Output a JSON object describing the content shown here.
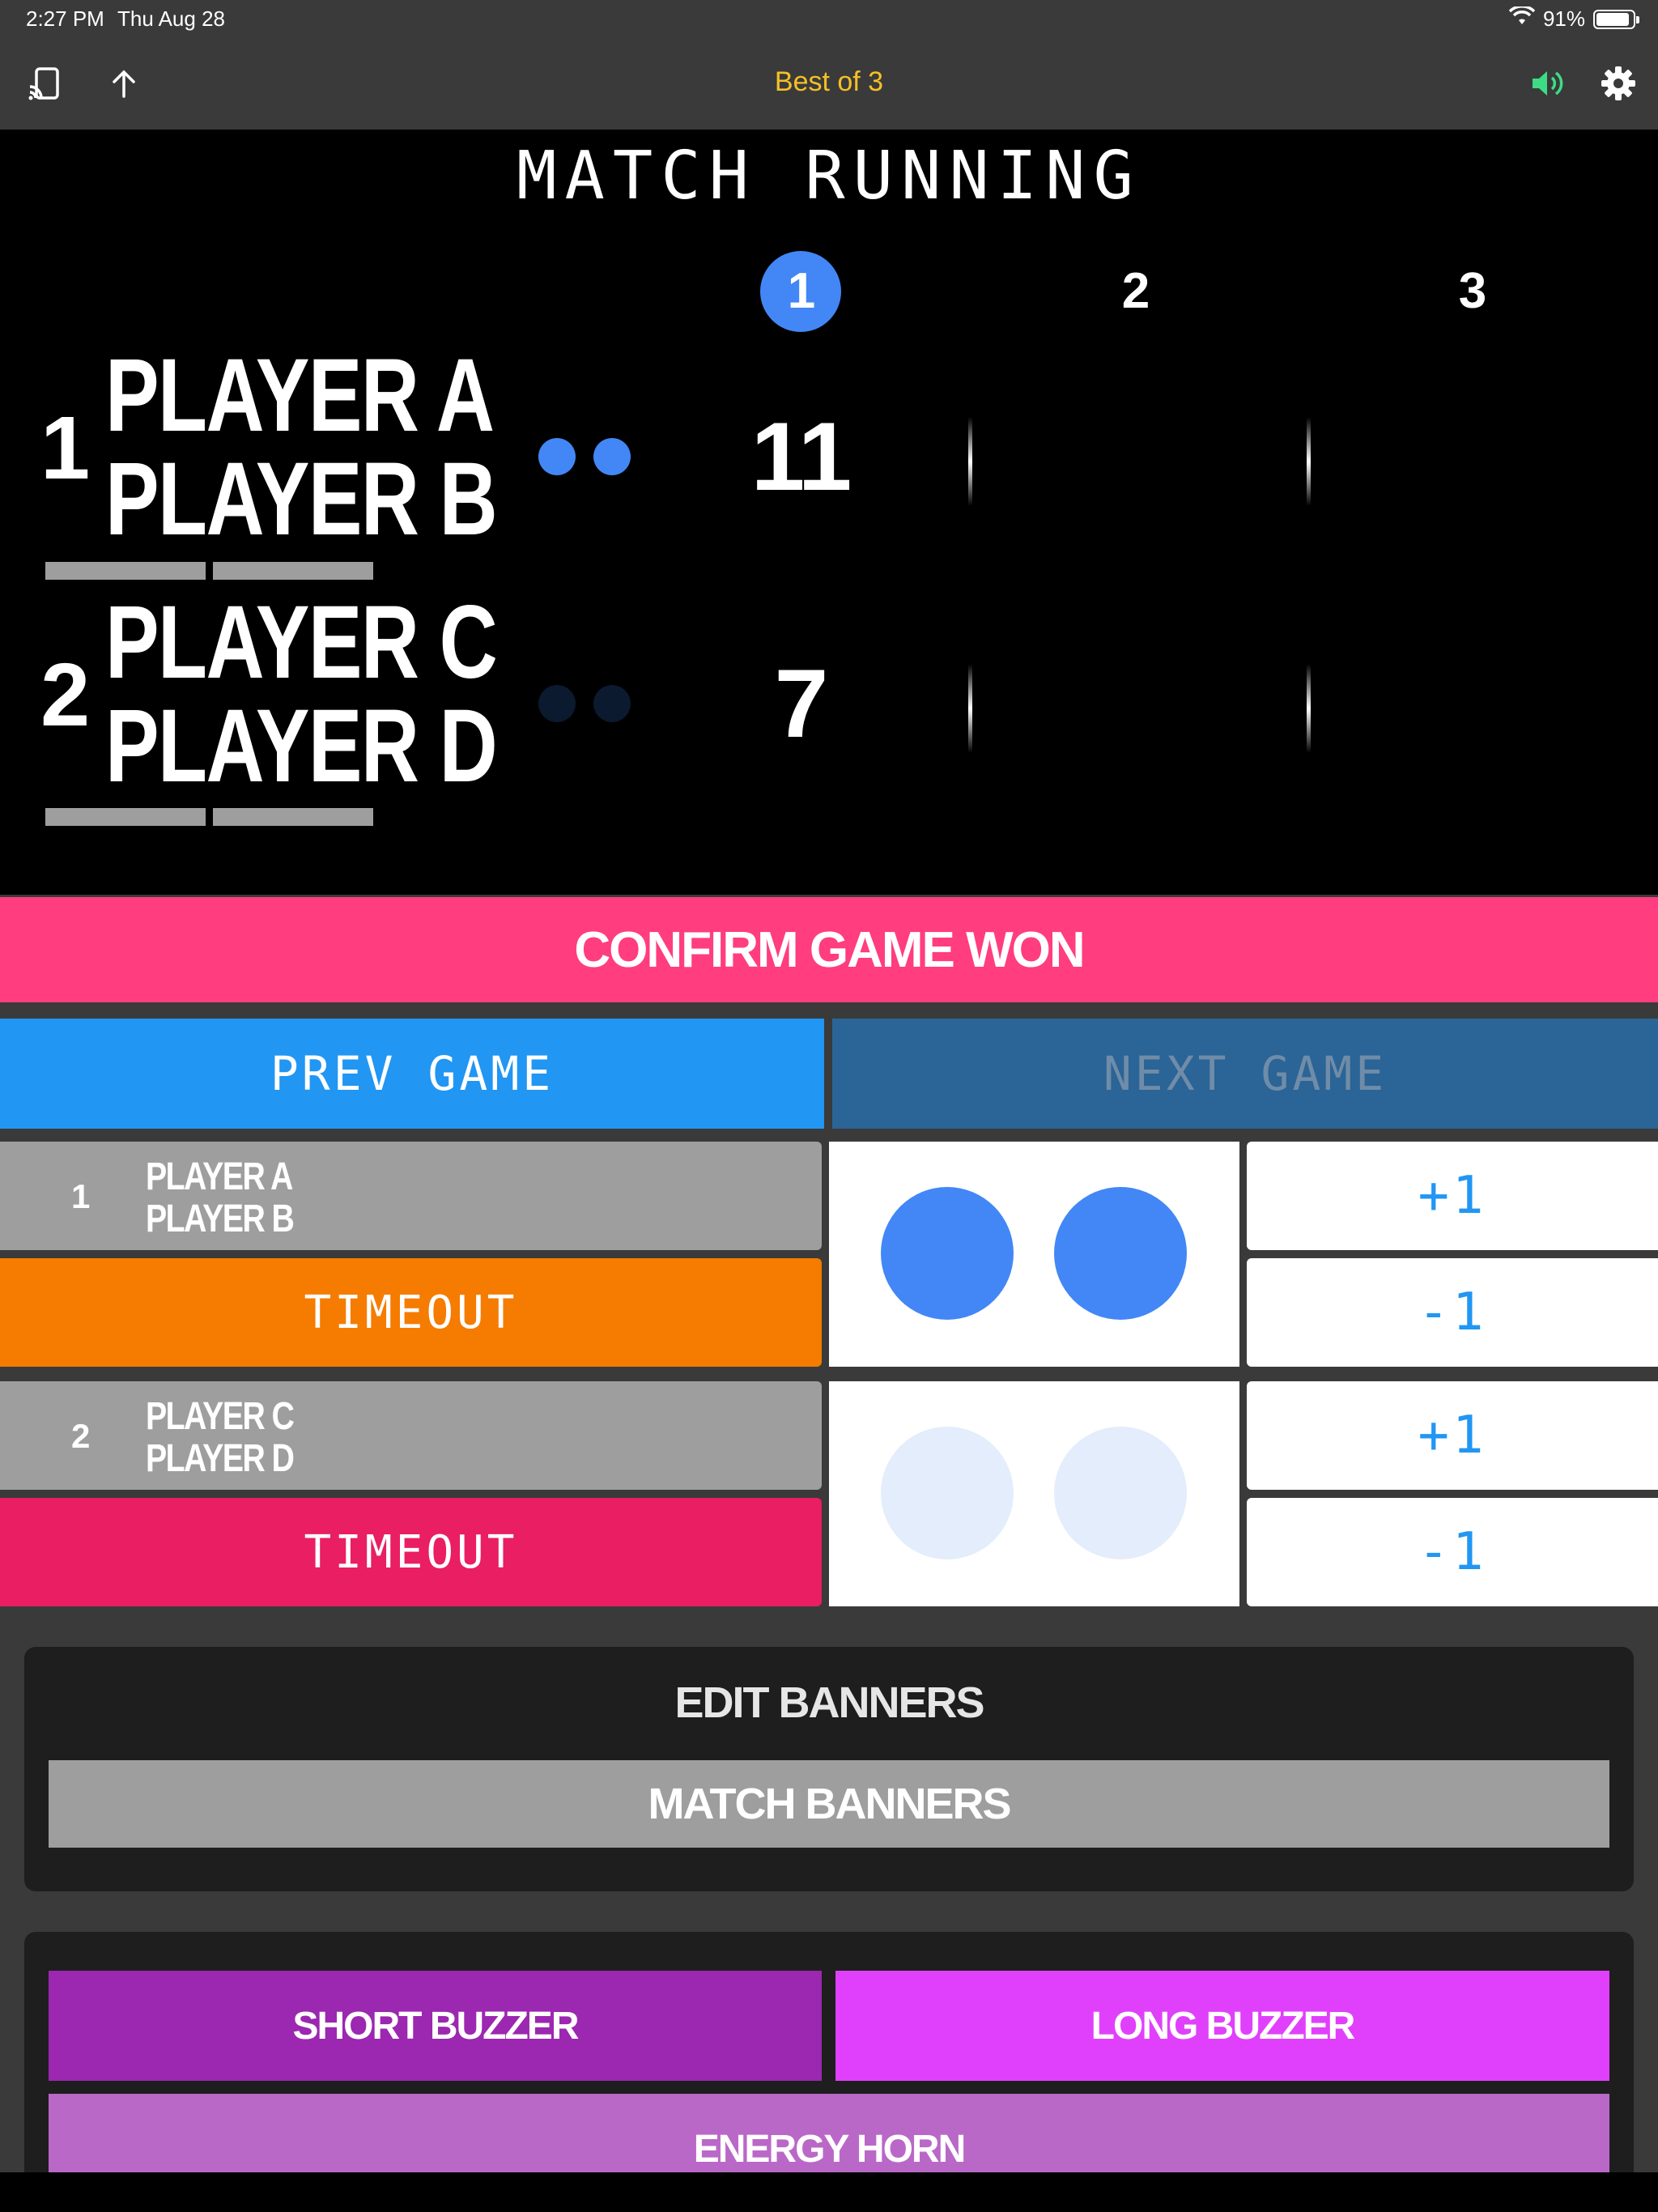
{
  "status_bar": {
    "time": "2:27 PM",
    "date": "Thu Aug 28",
    "battery": "91%",
    "battery_level": 0.91
  },
  "toolbar": {
    "title": "Best of 3",
    "icons": [
      "cast-icon",
      "arrow-up-icon",
      "volume-icon",
      "gear-icon"
    ],
    "accent_color": "#f5c026",
    "volume_color": "#3ddc84"
  },
  "scoreboard": {
    "status": "MATCH RUNNING",
    "game_headers": [
      "1",
      "2",
      "3"
    ],
    "active_game": 1,
    "teams": [
      {
        "number": "1",
        "player1": "PLAYER A",
        "player2": "PLAYER B",
        "scores": [
          "11",
          "",
          ""
        ],
        "dot_color": "#4287f5",
        "dots_active": true
      },
      {
        "number": "2",
        "player1": "PLAYER C",
        "player2": "PLAYER D",
        "scores": [
          "7",
          "",
          ""
        ],
        "dot_color": "#0b1a2e",
        "dots_active": false
      }
    ]
  },
  "controls": {
    "confirm_label": "CONFIRM GAME WON",
    "prev_label": "PREV GAME",
    "next_label": "NEXT GAME",
    "team1": {
      "number": "1",
      "player1": "PLAYER A",
      "player2": "PLAYER B",
      "timeout_label": "TIMEOUT",
      "timeout_color": "#f57c00",
      "dot_color": "#4287f5",
      "plus_label": "+1",
      "minus_label": "-1"
    },
    "team2": {
      "number": "2",
      "player1": "PLAYER C",
      "player2": "PLAYER D",
      "timeout_label": "TIMEOUT",
      "timeout_color": "#e91e63",
      "dot_color": "#e3edfb",
      "plus_label": "+1",
      "minus_label": "-1"
    }
  },
  "banners": {
    "title": "EDIT BANNERS",
    "match_banners_label": "MATCH BANNERS"
  },
  "sounds": {
    "short_buzzer": "SHORT BUZZER",
    "long_buzzer": "LONG BUZZER",
    "energy_horn": "ENERGY HORN"
  }
}
